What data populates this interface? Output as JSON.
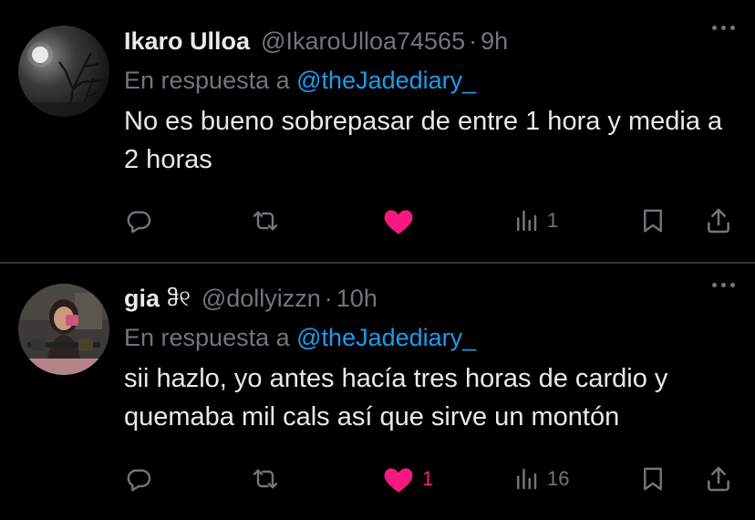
{
  "tweets": [
    {
      "name": "Ikaro Ulloa",
      "name_emoji": "",
      "handle": "@IkaroUlloa74565",
      "separator": "·",
      "time": "9h",
      "reply_prefix": "En respuesta a",
      "reply_to": "@theJadediary_",
      "text": "No es bueno sobrepasar de entre 1 hora y media a 2 horas",
      "liked": true,
      "likes": "",
      "views": "1"
    },
    {
      "name": "gia",
      "name_emoji": "ჵ୧",
      "handle": "@dollyizzn",
      "separator": "·",
      "time": "10h",
      "reply_prefix": "En respuesta a",
      "reply_to": "@theJadediary_",
      "text": "sii hazlo, yo antes hacía tres horas de cardio y quemaba mil cals así que sirve un montón",
      "liked": true,
      "likes": "1",
      "views": "16"
    }
  ],
  "colors": {
    "background": "#000000",
    "text": "#e7e9ea",
    "muted": "#71767b",
    "link": "#1d9bf0",
    "like": "#f91880",
    "divider": "#2f3336"
  },
  "icons": [
    "reply-icon",
    "retweet-icon",
    "heart-icon",
    "views-icon",
    "bookmark-icon",
    "share-icon",
    "more-icon"
  ]
}
